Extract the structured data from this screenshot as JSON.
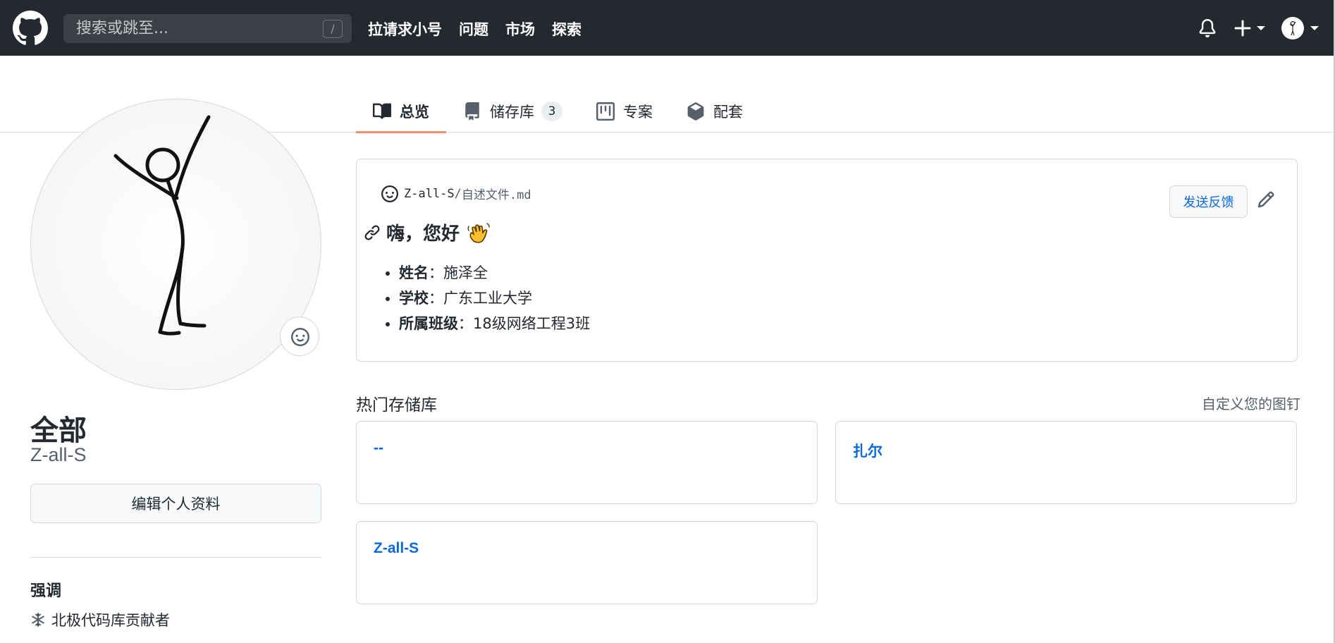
{
  "header": {
    "search_placeholder": "搜索或跳至...",
    "search_shortcut": "/",
    "nav": [
      "拉请求小号",
      "问题",
      "市场",
      "探索"
    ]
  },
  "tabs": [
    {
      "label": "总览",
      "icon": "book-icon",
      "active": true
    },
    {
      "label": "储存库",
      "icon": "repo-icon",
      "counter": "3"
    },
    {
      "label": "专案",
      "icon": "project-icon"
    },
    {
      "label": "配套",
      "icon": "package-icon"
    }
  ],
  "profile": {
    "fullname": "全部",
    "username": "Z-all-S",
    "edit_label": "编辑个人资料",
    "highlights_title": "强调",
    "highlights": [
      "北极代码库贡献者"
    ]
  },
  "readme": {
    "repo": "Z-all-S",
    "separator": "/",
    "file": "自述文件.md",
    "feedback_label": "发送反馈",
    "heading": "嗨，您好",
    "items": [
      {
        "key": "姓名",
        "value": "：施泽全"
      },
      {
        "key": "学校",
        "value": "：广东工业大学"
      },
      {
        "key": "所属班级",
        "value": "：18级网络工程3班"
      }
    ]
  },
  "pinned": {
    "title": "热门存储库",
    "customize": "自定义您的图钉",
    "repos": [
      "--",
      "扎尔",
      "Z-all-S"
    ]
  },
  "colors": {
    "header_bg": "#24292f",
    "link": "#0969da",
    "active_tab_underline": "#fd8c73"
  }
}
